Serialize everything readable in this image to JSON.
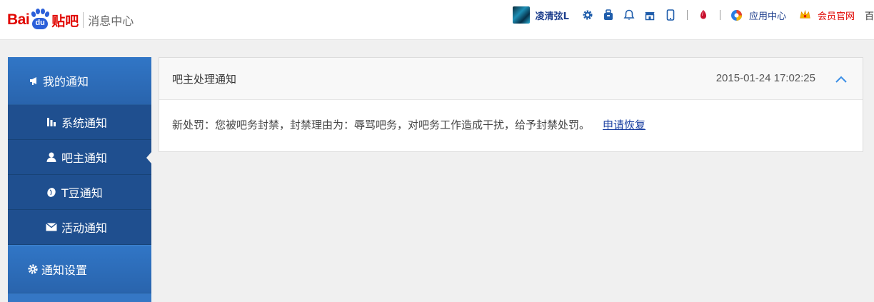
{
  "header": {
    "logo_bai": "Bai",
    "logo_du": "du",
    "logo_tieba": "贴吧",
    "subtitle": "消息中心"
  },
  "userbar": {
    "username": "凌清弦L",
    "app_center": "应用中心",
    "vip": "会员官网",
    "more": "百"
  },
  "sidebar": {
    "my_notice": "我的通知",
    "items": [
      {
        "label": "系统通知",
        "icon": "system-icon"
      },
      {
        "label": "吧主通知",
        "icon": "user-icon",
        "active": true
      },
      {
        "label": "T豆通知",
        "icon": "bean-icon"
      },
      {
        "label": "活动通知",
        "icon": "mail-icon"
      }
    ],
    "settings": "通知设置"
  },
  "notice": {
    "title": "吧主处理通知",
    "time": "2015-01-24 17:02:25",
    "content": "新处罚：您被吧务封禁，封禁理由为：辱骂吧务，对吧务工作造成干扰，给予封禁处罚。",
    "action": "申请恢复"
  },
  "colors": {
    "brand_red": "#e10601",
    "brand_blue": "#2b5fd9",
    "sidebar_blue": "#2c6ab4",
    "link_blue": "#1a3fa0"
  }
}
